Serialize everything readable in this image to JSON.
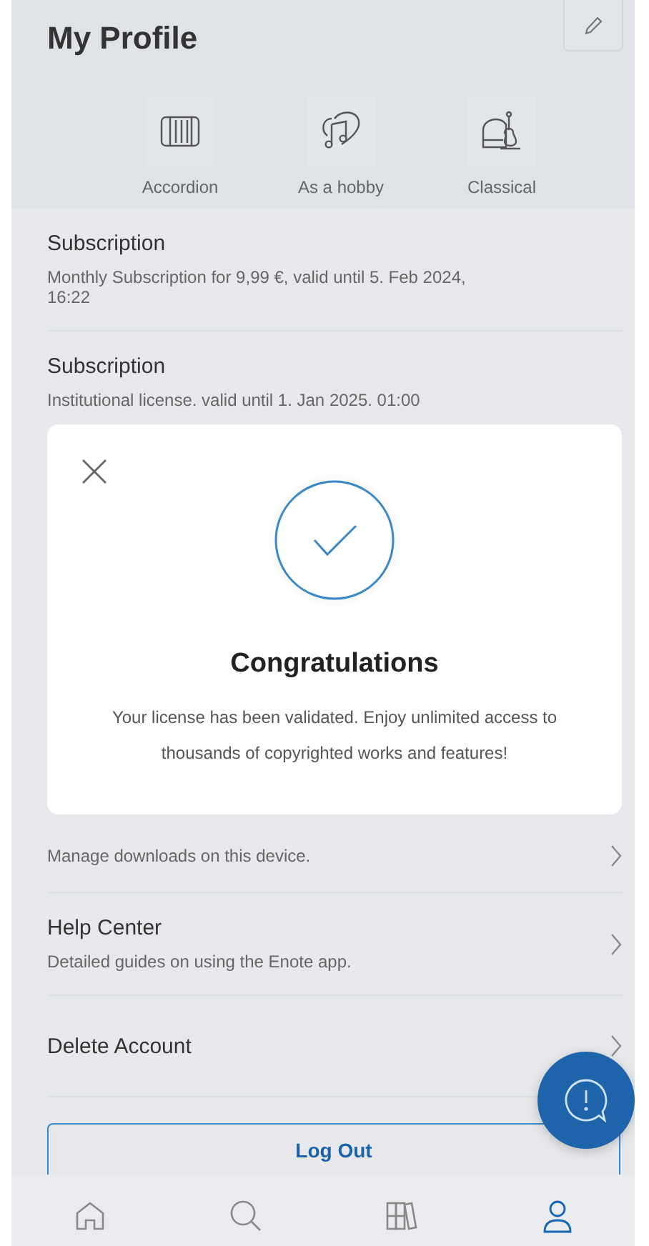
{
  "header": {
    "title": "My Profile",
    "interests": [
      {
        "kind": "accordion",
        "label": "Accordion"
      },
      {
        "kind": "hobby",
        "label": "As a hobby"
      },
      {
        "kind": "classical",
        "label": "Classical"
      }
    ]
  },
  "sections": [
    {
      "title": "Subscription",
      "subtitle": "Monthly Subscription for 9,99 €, valid until 5. Feb 2024, 16:22"
    },
    {
      "title": "Subscription",
      "subtitle": "Institutional license. valid until 1. Jan 2025. 01:00"
    }
  ],
  "sections_below": [
    {
      "subtitle": "Manage downloads on this device.",
      "chevron": true
    },
    {
      "title": "Help Center",
      "subtitle": "Detailed guides on using the Enote app.",
      "chevron": true
    },
    {
      "title": "Delete Account",
      "chevron": true
    }
  ],
  "logout": "Log Out",
  "dialog": {
    "title": "Congratulations",
    "message": "Your license has been validated. Enjoy unlimited access to thousands of copyrighted works and features!"
  },
  "nav": [
    {
      "kind": "home",
      "selected": false
    },
    {
      "kind": "search",
      "selected": false
    },
    {
      "kind": "library",
      "selected": false
    },
    {
      "kind": "account",
      "selected": true
    }
  ]
}
